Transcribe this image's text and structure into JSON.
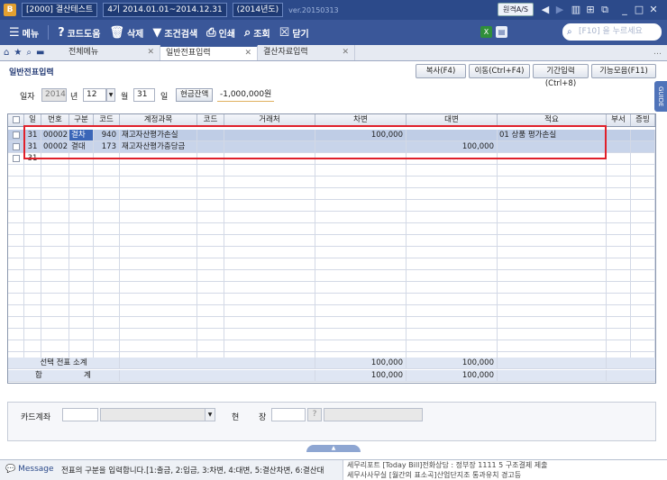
{
  "titlebar": {
    "logo": "B",
    "company": "[2000] 결산테스트",
    "period": "4기 2014.01.01~2014.12.31",
    "year": "(2014년도)",
    "version": "ver.20150313",
    "remote_btn": "원격A/S"
  },
  "toolbar": {
    "menu": "메뉴",
    "code_help": "코드도움",
    "delete": "삭제",
    "condition_search": "조건검색",
    "print": "인쇄",
    "view": "조회",
    "close": "닫기",
    "search_placeholder": "[F10] 을 누르세요"
  },
  "tabs": [
    {
      "label": "전체메뉴"
    },
    {
      "label": "일반전표입력"
    },
    {
      "label": "결산자료입력"
    }
  ],
  "header": {
    "page_title": "일반전표입력",
    "btn_copy": "복사(F4)",
    "btn_move": "이동(Ctrl+F4)",
    "btn_period": "기간입력(Ctrl+8)",
    "btn_functions": "기능모음(F11)"
  },
  "guide_label": "GUIDE",
  "date_row": {
    "label_date": "일자",
    "year": "2014",
    "label_year": "년",
    "month": "12",
    "label_month": "월",
    "day": "31",
    "label_day": "일",
    "cash_btn": "현금잔액",
    "cash_balance": "-1,000,000원"
  },
  "grid": {
    "columns": [
      "일",
      "번호",
      "구분",
      "코드",
      "계정과목",
      "코드",
      "거래처",
      "차변",
      "대변",
      "적요",
      "부서",
      "증빙"
    ],
    "rows": [
      {
        "day": "31",
        "no": "00002",
        "type": "결차",
        "code": "940",
        "account": "재고자산평가손실",
        "partner_code": "",
        "partner": "",
        "debit": "100,000",
        "credit": "",
        "memo": "01 상품 평가손실"
      },
      {
        "day": "31",
        "no": "00002",
        "type": "결대",
        "code": "173",
        "account": "재고자산평가충당금",
        "partner_code": "",
        "partner": "",
        "debit": "",
        "credit": "100,000",
        "memo": ""
      },
      {
        "day": "31",
        "no": "",
        "type": "",
        "code": "",
        "account": "",
        "partner_code": "",
        "partner": "",
        "debit": "",
        "credit": "",
        "memo": ""
      }
    ],
    "subtotal_label": "선택 전표 소계",
    "subtotal_debit": "100,000",
    "subtotal_credit": "100,000",
    "total_label_a": "합",
    "total_label_b": "계",
    "total_debit": "100,000",
    "total_credit": "100,000"
  },
  "card_row": {
    "label_card": "카드계좌",
    "label_hyeon": "현",
    "label_jang": "장",
    "help_btn": "?"
  },
  "message": {
    "label": "Message",
    "text": "전표의 구분을 입력합니다.[1:출금, 2:입금, 3:차변, 4:대변, 5:결산차변, 6:결산대",
    "news_line1": "세무리포트 [Today Bill]전화상담 : 정부장 1111 5 구조결제 제출",
    "news_line2": "세무사사무실 [월간의 표소곡]산업단지조 통과유치 경고등"
  }
}
